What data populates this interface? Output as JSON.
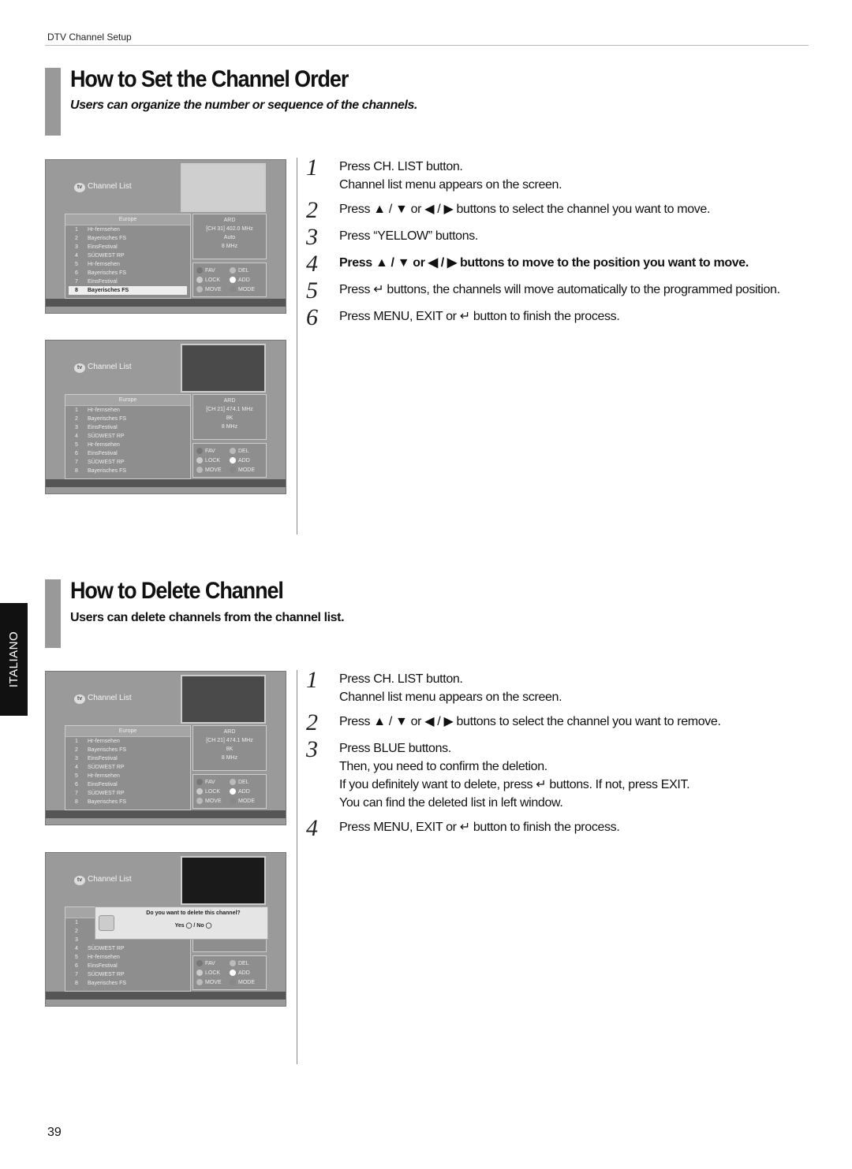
{
  "header": {
    "section": "DTV Channel Setup"
  },
  "side_tab": "ITALIANO",
  "page_number": "39",
  "sections": [
    {
      "title": "How to Set the Channel Order",
      "subtitle": "Users can organize the number or sequence of the channels.",
      "steps": [
        {
          "num": "1",
          "lines": [
            "Press CH. LIST button.",
            "Channel list menu appears on the screen."
          ],
          "bold": false
        },
        {
          "num": "2",
          "lines": [
            "Press ▲ / ▼ or ◀ / ▶ buttons to select the channel you want to move."
          ],
          "bold": false
        },
        {
          "num": "3",
          "lines": [
            "Press “YELLOW” buttons."
          ],
          "bold": false
        },
        {
          "num": "4",
          "lines": [
            "Press ▲ / ▼ or ◀ / ▶ buttons to move to the position you want to move."
          ],
          "bold": true
        },
        {
          "num": "5",
          "lines": [
            "Press ↵ buttons, the channels will move automatically to the programmed position."
          ],
          "bold": false
        },
        {
          "num": "6",
          "lines": [
            "Press MENU, EXIT or ↵ button to finish the process."
          ],
          "bold": false
        }
      ]
    },
    {
      "title": "How to Delete Channel",
      "subtitle": "Users can delete channels from the channel list.",
      "steps": [
        {
          "num": "1",
          "lines": [
            "Press CH. LIST button.",
            "Channel list menu appears on the screen."
          ],
          "bold": false
        },
        {
          "num": "2",
          "lines": [
            "Press ▲ / ▼ or ◀ / ▶ buttons to select the channel you want to remove."
          ],
          "bold": false
        },
        {
          "num": "3",
          "lines": [
            "Press BLUE buttons.",
            "Then, you need to confirm the deletion.",
            "If you definitely want to delete, press ↵ buttons. If not, press EXIT.",
            "You can find the deleted list in left window."
          ],
          "bold": false
        },
        {
          "num": "4",
          "lines": [
            "Press MENU, EXIT or ↵ button to finish the process."
          ],
          "bold": false
        }
      ]
    }
  ],
  "screens": [
    {
      "title": "Channel List",
      "group": "Europe",
      "info": [
        "ARD",
        "[CH 31]  402.0 MHz",
        "Auto",
        "8 MHz"
      ],
      "channels": [
        [
          "1",
          "Hr-fernsehen"
        ],
        [
          "2",
          "Bayerisches FS"
        ],
        [
          "3",
          "EinsFestival"
        ],
        [
          "4",
          "SÜDWEST RP"
        ],
        [
          "5",
          "Hr-fernsehen"
        ],
        [
          "6",
          "Bayerisches FS"
        ],
        [
          "7",
          "EinsFestival"
        ],
        [
          "8",
          "Bayerisches FS"
        ]
      ],
      "selected": 7,
      "buttons": [
        [
          "FAV",
          "#777"
        ],
        [
          "DEL",
          "#bbb"
        ],
        [
          "LOCK",
          "#ccc"
        ],
        [
          "ADD",
          "#fff"
        ],
        [
          "MOVE",
          "#bbb"
        ],
        [
          "MODE",
          "#888"
        ]
      ],
      "video": "#cfcfcf"
    },
    {
      "title": "Channel List",
      "group": "Europe",
      "info": [
        "ARD",
        "[CH 21]  474.1 MHz",
        "8K",
        "8 MHz"
      ],
      "channels": [
        [
          "1",
          "Hr-fernsehen"
        ],
        [
          "2",
          "Bayerisches FS"
        ],
        [
          "3",
          "EinsFestival"
        ],
        [
          "4",
          "SÜDWEST RP"
        ],
        [
          "5",
          "Hr-fernsehen"
        ],
        [
          "6",
          "EinsFestival"
        ],
        [
          "7",
          "SÜDWEST RP"
        ],
        [
          "8",
          "Bayerisches FS"
        ]
      ],
      "selected": -1,
      "buttons": [
        [
          "FAV",
          "#777"
        ],
        [
          "DEL",
          "#bbb"
        ],
        [
          "LOCK",
          "#ccc"
        ],
        [
          "ADD",
          "#fff"
        ],
        [
          "MOVE",
          "#bbb"
        ],
        [
          "MODE",
          "#888"
        ]
      ],
      "video": "#4a4a4a"
    },
    {
      "title": "Channel List",
      "group": "Europe",
      "info": [
        "ARD",
        "[CH 21]  474.1 MHz",
        "8K",
        "8 MHz"
      ],
      "channels": [
        [
          "1",
          "Hr-fernsehen"
        ],
        [
          "2",
          "Bayerisches FS"
        ],
        [
          "3",
          "EinsFestival"
        ],
        [
          "4",
          "SÜDWEST RP"
        ],
        [
          "5",
          "Hr-fernsehen"
        ],
        [
          "6",
          "EinsFestival"
        ],
        [
          "7",
          "SÜDWEST RP"
        ],
        [
          "8",
          "Bayerisches FS"
        ]
      ],
      "selected": -1,
      "buttons": [
        [
          "FAV",
          "#777"
        ],
        [
          "DEL",
          "#bbb"
        ],
        [
          "LOCK",
          "#ccc"
        ],
        [
          "ADD",
          "#fff"
        ],
        [
          "MOVE",
          "#bbb"
        ],
        [
          "MODE",
          "#888"
        ]
      ],
      "video": "#4a4a4a"
    },
    {
      "title": "Channel List",
      "group": "Europe",
      "info": [],
      "channels": [
        [
          "1",
          ""
        ],
        [
          "2",
          ""
        ],
        [
          "3",
          ""
        ],
        [
          "4",
          "SÜDWEST RP"
        ],
        [
          "5",
          "Hr-fernsehen"
        ],
        [
          "6",
          "EinsFestival"
        ],
        [
          "7",
          "SÜDWEST RP"
        ],
        [
          "8",
          "Bayerisches FS"
        ]
      ],
      "selected": -1,
      "buttons": [
        [
          "FAV",
          "#777"
        ],
        [
          "DEL",
          "#bbb"
        ],
        [
          "LOCK",
          "#ccc"
        ],
        [
          "ADD",
          "#fff"
        ],
        [
          "MOVE",
          "#bbb"
        ],
        [
          "MODE",
          "#888"
        ]
      ],
      "video": "#1a1a1a",
      "dialog": {
        "question": "Do you want to delete this channel?",
        "yes": "Yes",
        "no": "No"
      }
    }
  ]
}
